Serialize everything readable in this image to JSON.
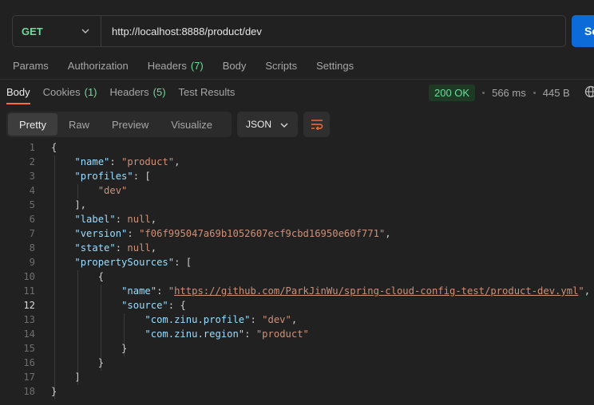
{
  "request": {
    "method": "GET",
    "url": "http://localhost:8888/product/dev",
    "send_label": "Se"
  },
  "request_tabs": [
    {
      "label": "Params",
      "count": ""
    },
    {
      "label": "Authorization",
      "count": ""
    },
    {
      "label": "Headers",
      "count": "(7)"
    },
    {
      "label": "Body",
      "count": ""
    },
    {
      "label": "Scripts",
      "count": ""
    },
    {
      "label": "Settings",
      "count": ""
    }
  ],
  "response_tabs": [
    {
      "label": "Body",
      "count": ""
    },
    {
      "label": "Cookies",
      "count": "(1)"
    },
    {
      "label": "Headers",
      "count": "(5)"
    },
    {
      "label": "Test Results",
      "count": ""
    }
  ],
  "status": {
    "code": "200 OK",
    "time": "566 ms",
    "size": "445 B"
  },
  "view_modes": [
    "Pretty",
    "Raw",
    "Preview",
    "Visualize"
  ],
  "format": "JSON",
  "code_lines": [
    {
      "n": "1",
      "parts": [
        [
          "p",
          "{"
        ]
      ]
    },
    {
      "n": "2",
      "parts": [
        [
          "p",
          "    "
        ],
        [
          "k",
          "\"name\""
        ],
        [
          "p",
          ": "
        ],
        [
          "s",
          "\"product\""
        ],
        [
          "p",
          ","
        ]
      ]
    },
    {
      "n": "3",
      "parts": [
        [
          "p",
          "    "
        ],
        [
          "k",
          "\"profiles\""
        ],
        [
          "p",
          ": ["
        ]
      ]
    },
    {
      "n": "4",
      "parts": [
        [
          "p",
          "        "
        ],
        [
          "s",
          "\"dev\""
        ]
      ]
    },
    {
      "n": "5",
      "parts": [
        [
          "p",
          "    ],"
        ]
      ]
    },
    {
      "n": "6",
      "parts": [
        [
          "p",
          "    "
        ],
        [
          "k",
          "\"label\""
        ],
        [
          "p",
          ": "
        ],
        [
          "n",
          "null"
        ],
        [
          "p",
          ","
        ]
      ]
    },
    {
      "n": "7",
      "parts": [
        [
          "p",
          "    "
        ],
        [
          "k",
          "\"version\""
        ],
        [
          "p",
          ": "
        ],
        [
          "s",
          "\"f06f995047a69b1052607ecf9cbd16950e60f771\""
        ],
        [
          "p",
          ","
        ]
      ]
    },
    {
      "n": "8",
      "parts": [
        [
          "p",
          "    "
        ],
        [
          "k",
          "\"state\""
        ],
        [
          "p",
          ": "
        ],
        [
          "n",
          "null"
        ],
        [
          "p",
          ","
        ]
      ]
    },
    {
      "n": "9",
      "parts": [
        [
          "p",
          "    "
        ],
        [
          "k",
          "\"propertySources\""
        ],
        [
          "p",
          ": ["
        ]
      ]
    },
    {
      "n": "10",
      "parts": [
        [
          "p",
          "        {"
        ]
      ]
    },
    {
      "n": "11",
      "parts": [
        [
          "p",
          "            "
        ],
        [
          "k",
          "\"name\""
        ],
        [
          "p",
          ": "
        ],
        [
          "s",
          "\""
        ],
        [
          "u",
          "https://github.com/ParkJinWu/spring-cloud-config-test/product-dev.yml"
        ],
        [
          "s",
          "\""
        ],
        [
          "p",
          ","
        ]
      ]
    },
    {
      "n": "12",
      "parts": [
        [
          "p",
          "            "
        ],
        [
          "k",
          "\"source\""
        ],
        [
          "p",
          ": {"
        ]
      ]
    },
    {
      "n": "13",
      "parts": [
        [
          "p",
          "                "
        ],
        [
          "k",
          "\"com.zinu.profile\""
        ],
        [
          "p",
          ": "
        ],
        [
          "s",
          "\"dev\""
        ],
        [
          "p",
          ","
        ]
      ]
    },
    {
      "n": "14",
      "parts": [
        [
          "p",
          "                "
        ],
        [
          "k",
          "\"com.zinu.region\""
        ],
        [
          "p",
          ": "
        ],
        [
          "s",
          "\"product\""
        ]
      ]
    },
    {
      "n": "15",
      "parts": [
        [
          "p",
          "            }"
        ]
      ]
    },
    {
      "n": "16",
      "parts": [
        [
          "p",
          "        }"
        ]
      ]
    },
    {
      "n": "17",
      "parts": [
        [
          "p",
          "    ]"
        ]
      ]
    },
    {
      "n": "18",
      "parts": [
        [
          "p",
          "}"
        ]
      ]
    }
  ],
  "current_line": "12",
  "icons": {
    "method_chevron": "chevron-down-icon",
    "format_chevron": "chevron-down-icon",
    "wrap": "wrap-lines-icon",
    "globe": "globe-icon"
  },
  "colors": {
    "accent": "#ff6c37",
    "method_green": "#6bdd9a",
    "send_blue": "#0c6bd8"
  }
}
